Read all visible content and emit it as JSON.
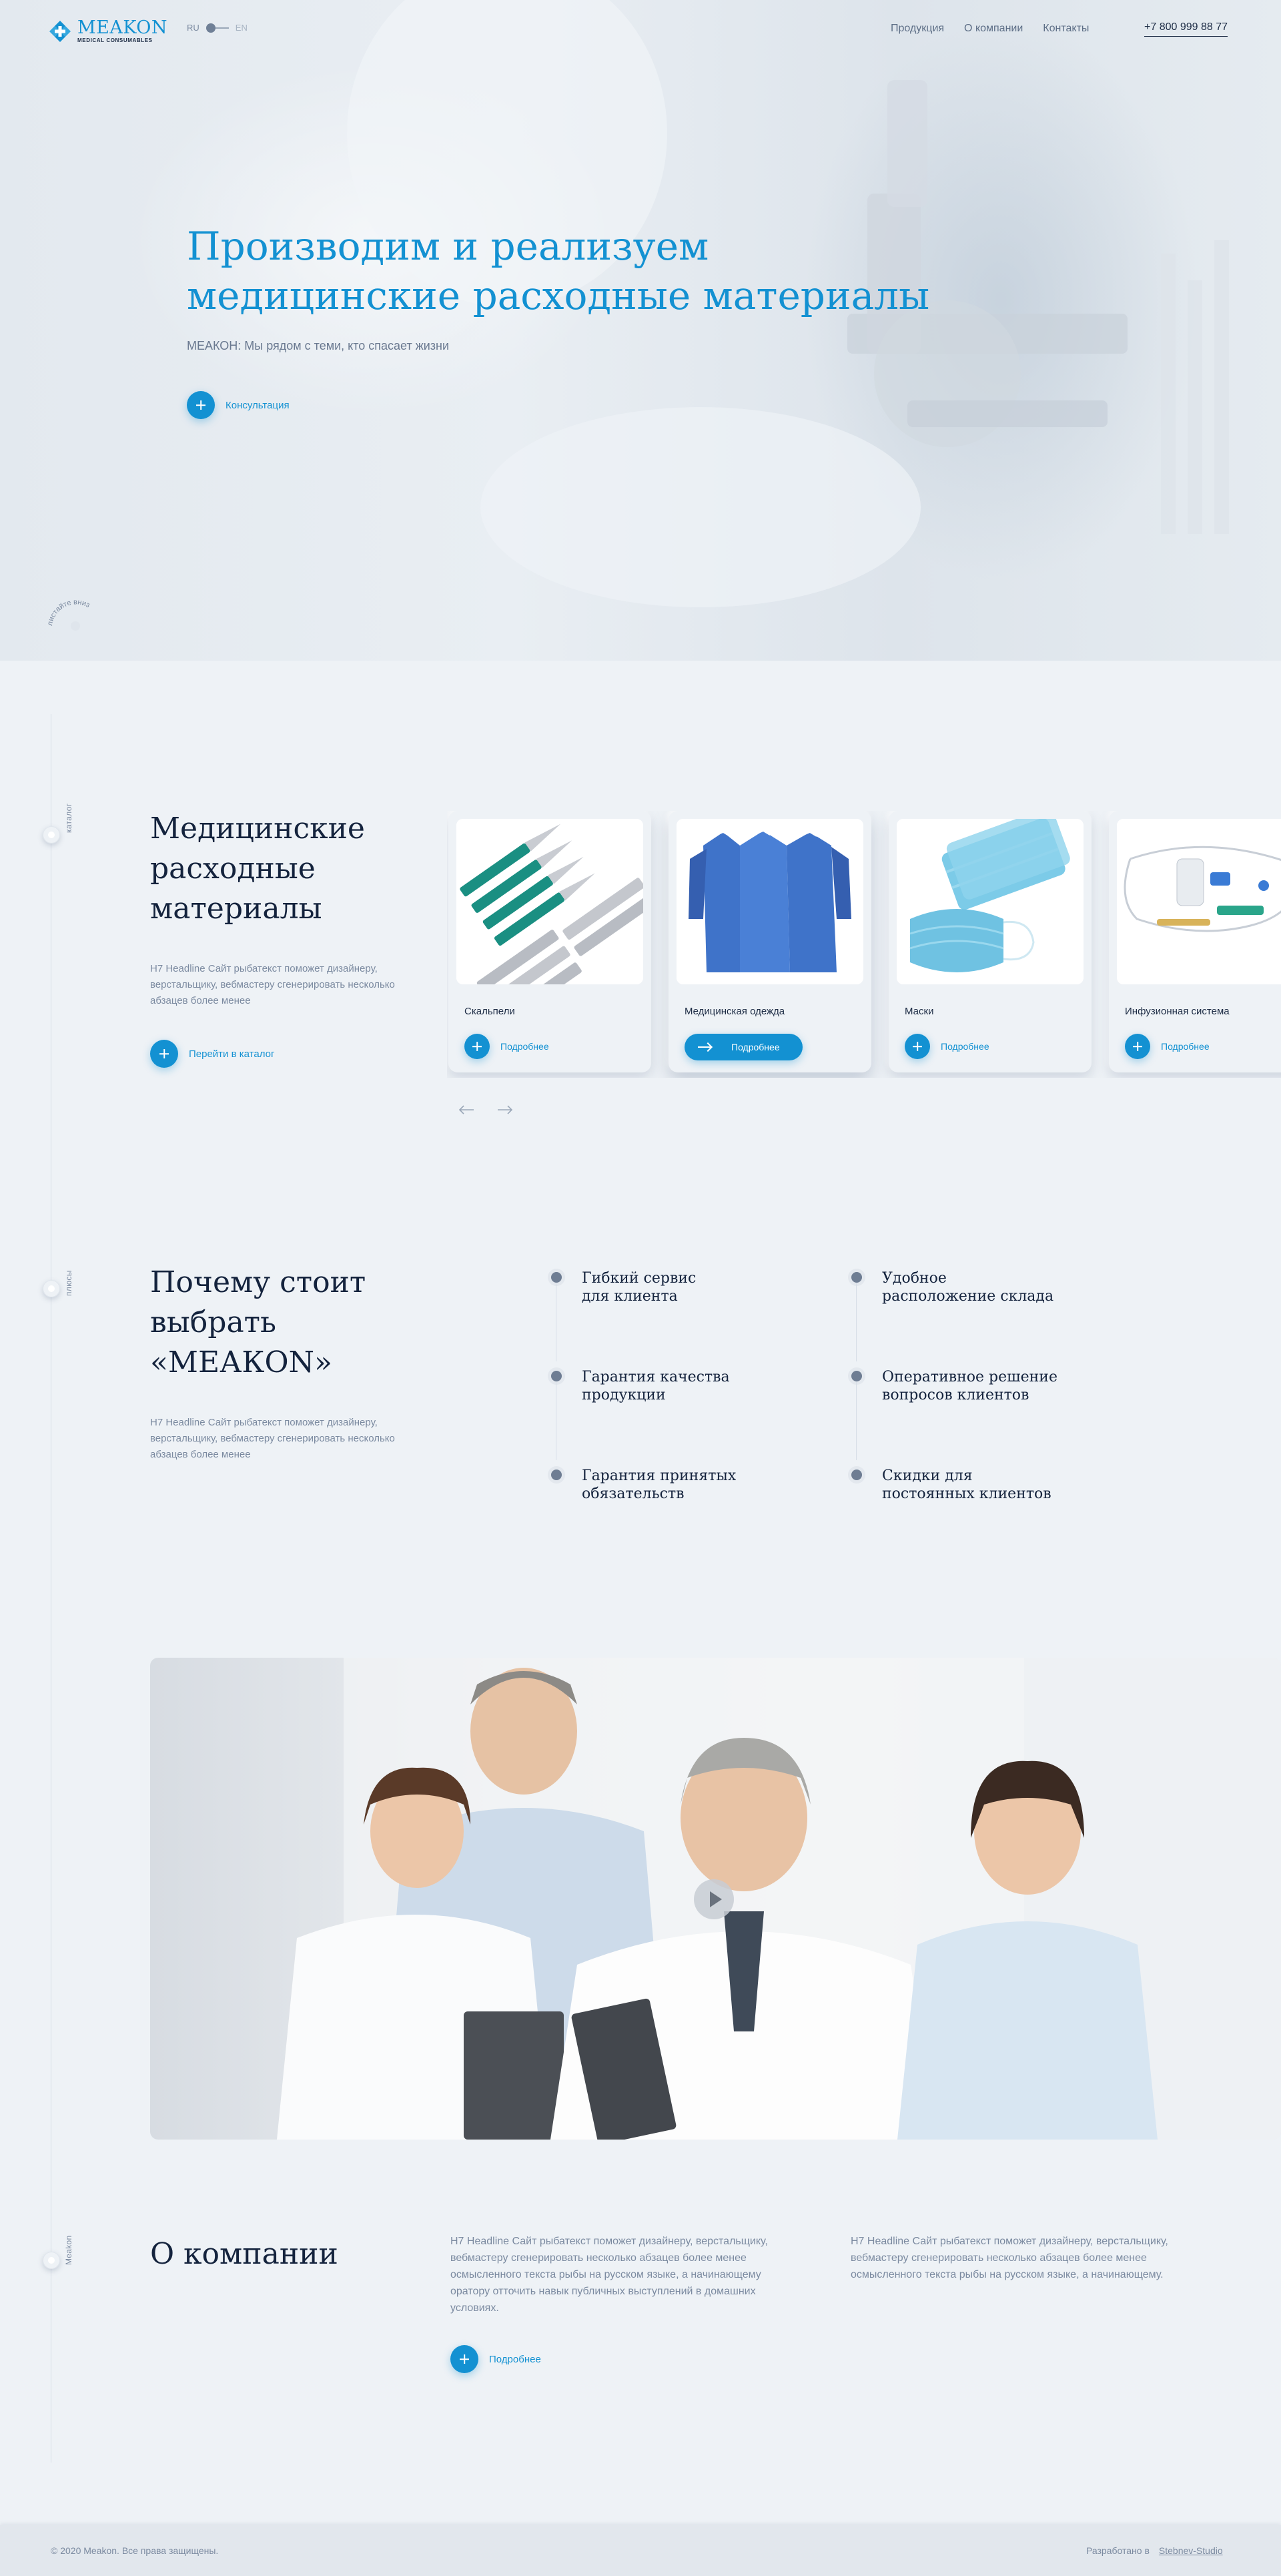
{
  "header": {
    "logo_name": "MEAKON",
    "logo_sub": "MEDICAL CONSUMABLES",
    "lang_ru": "RU",
    "lang_en": "EN",
    "nav": [
      "Продукция",
      "О компании",
      "Контакты"
    ],
    "phone": "+7 800 999 88 77"
  },
  "hero": {
    "title_line1": "Производим и реализуем",
    "title_line2": "медицинские расходные материалы",
    "subtitle": "МЕАКОН: Мы рядом с теми, кто спасает жизни",
    "cta": "Консультация",
    "scroll_hint": "листайте вниз"
  },
  "rail_labels": {
    "catalog": "каталог",
    "pluses": "плюсы",
    "about": "Meakon"
  },
  "catalog": {
    "title_lines": [
      "Медицинские",
      "расходные",
      "материалы"
    ],
    "text": "H7 Headline Сайт рыбатекст поможет дизайнеру, верстальщику, вебмастеру сгенерировать несколько абзацев более менее",
    "cta": "Перейти в каталог",
    "cards": [
      {
        "name": "Скальпели",
        "cta": "Подробнее",
        "icon": "scalpel-image"
      },
      {
        "name": "Медицинская одежда",
        "cta": "Подробнее",
        "icon": "medical-gown-image"
      },
      {
        "name": "Маски",
        "cta": "Подробнее",
        "icon": "face-mask-image"
      },
      {
        "name": "Инфузионная система",
        "cta": "Подробнее",
        "icon": "infusion-set-image"
      }
    ]
  },
  "why": {
    "title_lines": [
      "Почему стоит",
      "выбрать",
      "«МЕАКОN»"
    ],
    "text": "H7 Headline Сайт рыбатекст поможет дизайнеру, верстальщику, вебмастеру сгенерировать несколько абзацев более менее",
    "features": [
      {
        "l1": "Гибкий сервис",
        "l2": "для клиента"
      },
      {
        "l1": "Удобное",
        "l2": "расположение склада"
      },
      {
        "l1": "Гарантия качества",
        "l2": "продукции"
      },
      {
        "l1": "Оперативное решение",
        "l2": "вопросов клиентов"
      },
      {
        "l1": "Гарантия принятых",
        "l2": "обязательств"
      },
      {
        "l1": "Скидки для",
        "l2": "постоянных клиентов"
      }
    ]
  },
  "about": {
    "title": "О компании",
    "col1": "H7 Headline Сайт рыбатекст поможет дизайнеру, верстальщику, вебмастеру сгенерировать несколько абзацев более менее осмысленного текста рыбы на русском языке, а начинающему оратору отточить навык публичных выступлений в домашних условиях.",
    "col2": "H7 Headline Сайт рыбатекст поможет дизайнеру, верстальщику, вебмастеру сгенерировать несколько абзацев более менее осмысленного текста рыбы на русском языке, а начинающему.",
    "cta": "Подробнее"
  },
  "footer": {
    "copyright": "© 2020 Meakon. Все права защищены.",
    "dev_label": "Разработано в",
    "dev_link": "Stebnev-Studio"
  },
  "colors": {
    "accent": "#1391d2",
    "text_dark": "#14233d",
    "text_muted": "#7b8aa0",
    "background": "#eef2f6"
  }
}
